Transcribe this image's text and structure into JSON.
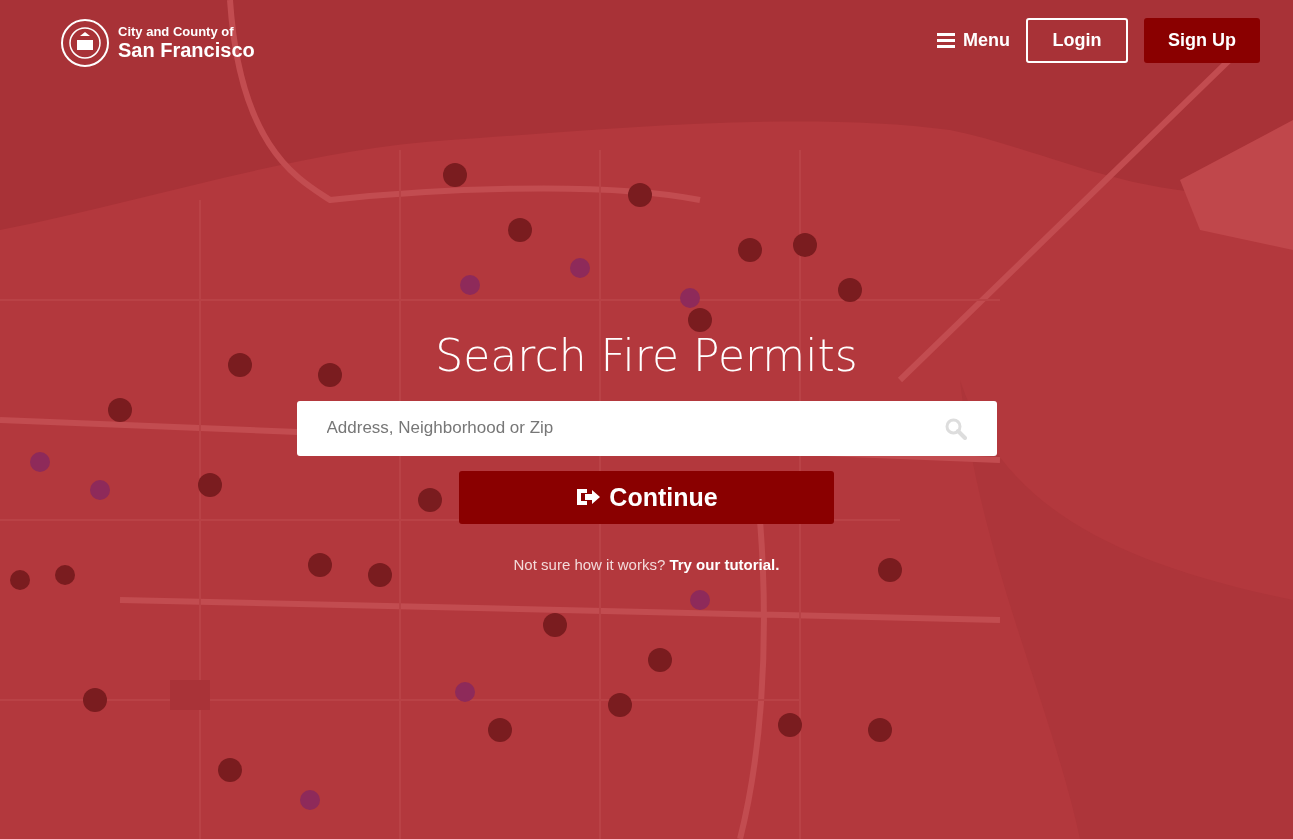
{
  "header": {
    "logo": {
      "line_1": "City and County of",
      "line_2": "San Francisco"
    },
    "menu": "Menu",
    "login": "Login",
    "signup": "Sign Up"
  },
  "hero": {
    "title": "Search Fire Permits",
    "search": {
      "placeholder": "Address, Neighborhood or Zip"
    },
    "continue": "Continue",
    "help": {
      "prompt": "Not sure how it works?",
      "link": "Try our tutorial."
    }
  }
}
